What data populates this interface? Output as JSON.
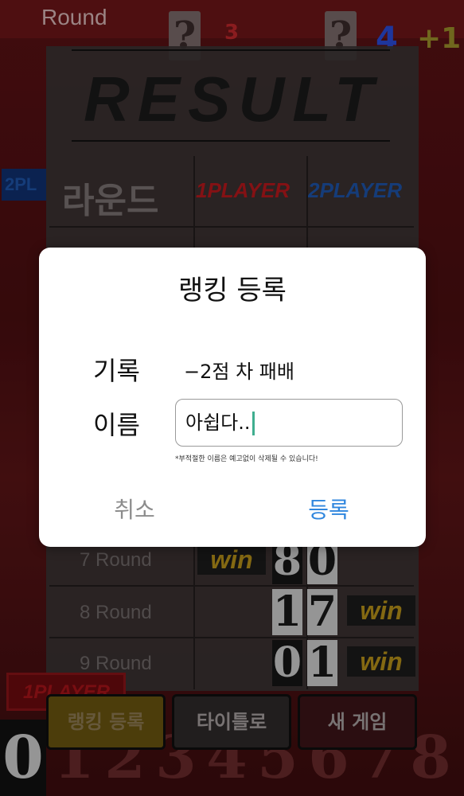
{
  "game": {
    "round_label": "Round",
    "hidden_card": "?",
    "round_number": "3",
    "score_count": "4",
    "score_delta": "+1",
    "result_title": "RESULT",
    "header": {
      "round": "라운드",
      "p1": "1PLAYER",
      "p2": "2PLAYER"
    },
    "side_p2_label": "2PL",
    "side_p1_label": "1PLAYER",
    "rows": [
      {
        "label": "7 Round",
        "p1_win": "win",
        "cards": [
          "8",
          "0"
        ],
        "p2_win": ""
      },
      {
        "label": "8 Round",
        "p1_win": "",
        "cards": [
          "1",
          "7"
        ],
        "p2_win": "win"
      },
      {
        "label": "9 Round",
        "p1_win": "",
        "cards": [
          "0",
          "1"
        ],
        "p2_win": "win"
      }
    ],
    "buttons": {
      "ranking": "랭킹 등록",
      "title": "타이틀로",
      "new_game": "새 게임"
    },
    "digits": [
      "0",
      "1",
      "2",
      "3",
      "4",
      "5",
      "6",
      "7",
      "8"
    ]
  },
  "dialog": {
    "title": "랭킹 등록",
    "record_label": "기록",
    "record_value": "−2점 차 패배",
    "name_label": "이름",
    "name_value": "아쉽다..",
    "notice": "*부적절한 이름은 예고없이 삭제될 수 있습니다!",
    "cancel_label": "취소",
    "confirm_label": "등록"
  }
}
